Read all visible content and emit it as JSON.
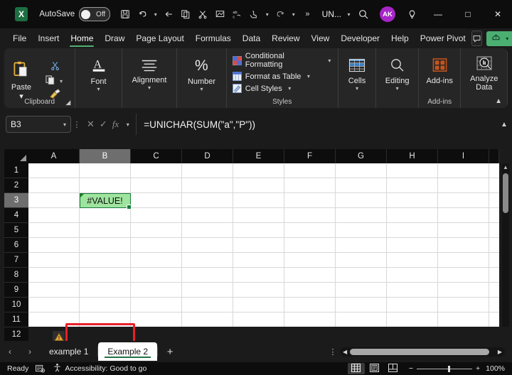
{
  "titlebar": {
    "app_logo": "excel-logo",
    "autosave_label": "AutoSave",
    "autosave_state": "Off",
    "filename": "UN...",
    "qat": [
      {
        "name": "save-button",
        "icon": "save-icon"
      },
      {
        "name": "undo-button",
        "icon": "undo-icon"
      },
      {
        "name": "back-button",
        "icon": "back-arrow-icon"
      },
      {
        "name": "copy-button",
        "icon": "copy-icon"
      },
      {
        "name": "cut-button",
        "icon": "scissors-icon"
      },
      {
        "name": "format-painter-button",
        "icon": "format-painter-icon"
      },
      {
        "name": "spelling-button",
        "icon": "spelling-abc-icon"
      },
      {
        "name": "touch-mode-button",
        "icon": "touch-pointer-icon"
      },
      {
        "name": "redo-button",
        "icon": "redo-icon"
      }
    ],
    "overflow_label": "»",
    "search_icon": "search-icon",
    "account_initials": "AK",
    "tips_icon": "lightbulb-icon",
    "minimize": "—",
    "maximize": "□",
    "close": "✕"
  },
  "ribbon_tabs": {
    "items": [
      {
        "label": "File",
        "active": false
      },
      {
        "label": "Insert",
        "active": false
      },
      {
        "label": "Home",
        "active": true
      },
      {
        "label": "Draw",
        "active": false
      },
      {
        "label": "Page Layout",
        "active": false
      },
      {
        "label": "Formulas",
        "active": false
      },
      {
        "label": "Data",
        "active": false
      },
      {
        "label": "Review",
        "active": false
      },
      {
        "label": "View",
        "active": false
      },
      {
        "label": "Developer",
        "active": false
      },
      {
        "label": "Help",
        "active": false
      },
      {
        "label": "Power Pivot",
        "active": false
      }
    ],
    "comment_icon": "comment-icon",
    "share_label": "",
    "share_icon": "share-icon",
    "accent_green": "#4caf72",
    "active_underline": "#51b071"
  },
  "ribbon": {
    "clipboard": {
      "paste_label": "Paste",
      "cut_name": "cut-icon",
      "copy_name": "copy-icon",
      "format_painter_name": "format-painter-icon",
      "group_label": "Clipboard"
    },
    "font": {
      "label": "Font"
    },
    "alignment": {
      "label": "Alignment"
    },
    "number": {
      "label": "Number"
    },
    "styles": {
      "items": [
        {
          "label": "Conditional Formatting",
          "icon": "conditional-formatting-icon"
        },
        {
          "label": "Format as Table",
          "icon": "format-as-table-icon"
        },
        {
          "label": "Cell Styles",
          "icon": "cell-styles-icon"
        }
      ],
      "group_label": "Styles"
    },
    "cells": {
      "label": "Cells"
    },
    "editing": {
      "label": "Editing"
    },
    "addins": {
      "label": "Add-ins",
      "group_label": "Add-ins"
    },
    "analyze_data": {
      "label_line1": "Analyze",
      "label_line2": "Data"
    },
    "collapse_icon": "chevron-up-icon"
  },
  "formula_bar": {
    "name_box": "B3",
    "cancel_icon": "cancel-x-icon",
    "enter_icon": "check-icon",
    "fx_label": "fx",
    "formula": "=UNICHAR(SUM(\"a\",\"P\"))",
    "expand_icon": "chevron-up-icon"
  },
  "grid": {
    "columns": [
      "A",
      "B",
      "C",
      "D",
      "E",
      "F",
      "G",
      "H",
      "I"
    ],
    "rows": [
      "1",
      "2",
      "3",
      "4",
      "5",
      "6",
      "7",
      "8",
      "9",
      "10",
      "11",
      "12"
    ],
    "selected_column": "B",
    "selected_row": "3",
    "cells": {
      "B3": {
        "value": "#VALUE!",
        "fill_color": "#9ee49e",
        "has_error_indicator": true
      }
    },
    "error_tag_icon": "warning-triangle-icon",
    "highlight_box_color": "#e8202a"
  },
  "sheet_tabs": {
    "prev_icon": "chevron-left-icon",
    "next_icon": "chevron-right-icon",
    "tabs": [
      {
        "label": "example 1",
        "active": false
      },
      {
        "label": "Example 2",
        "active": true
      }
    ],
    "add_label": "+",
    "overflow_icon": "vertical-dots-icon"
  },
  "status_bar": {
    "status": "Ready",
    "macro_icon": "record-macro-icon",
    "accessibility_icon": "accessibility-icon",
    "accessibility_text": "Accessibility: Good to go",
    "views": [
      {
        "name": "normal-view",
        "icon": "grid-view-icon",
        "active": true
      },
      {
        "name": "page-layout-view",
        "icon": "page-layout-icon",
        "active": false
      },
      {
        "name": "page-break-view",
        "icon": "page-break-icon",
        "active": false
      }
    ],
    "zoom_out": "−",
    "zoom_in": "+",
    "zoom_level": "100%"
  }
}
